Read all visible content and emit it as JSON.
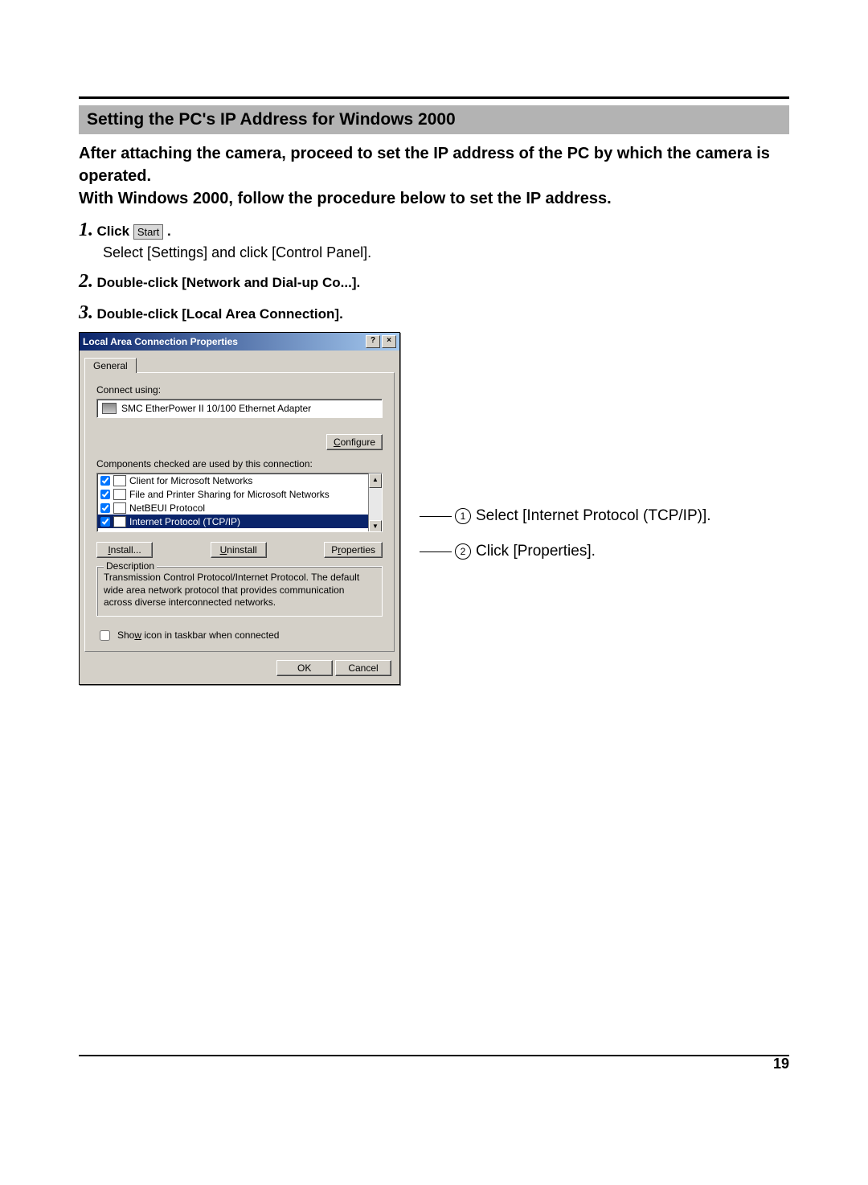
{
  "section_heading": "Setting the PC's IP Address for Windows 2000",
  "intro_line1": "After attaching the camera, proceed to set the IP address of the PC by which the camera is operated.",
  "intro_line2": "With Windows 2000, follow the procedure below to set the IP address.",
  "steps": {
    "s1_num": "1.",
    "s1_bold_prefix": "Click ",
    "s1_start_label": "Start",
    "s1_bold_suffix": " .",
    "s1_body": "Select [Settings] and click [Control Panel].",
    "s2_num": "2.",
    "s2_bold": "Double-click [Network and Dial-up Co...].",
    "s3_num": "3.",
    "s3_bold": "Double-click [Local Area Connection]."
  },
  "dialog": {
    "title": "Local Area Connection Properties",
    "help_btn": "?",
    "close_btn": "×",
    "tab": "General",
    "connect_label": "Connect using:",
    "adapter": "SMC EtherPower II 10/100 Ethernet Adapter",
    "configure_btn": "Configure",
    "components_label": "Components checked are used by this connection:",
    "components": [
      "Client for Microsoft Networks",
      "File and Printer Sharing for Microsoft Networks",
      "NetBEUI Protocol",
      "Internet Protocol (TCP/IP)"
    ],
    "install_btn": "Install...",
    "uninstall_btn": "Uninstall",
    "properties_btn": "Properties",
    "desc_legend": "Description",
    "desc_text": "Transmission Control Protocol/Internet Protocol. The default wide area network protocol that provides communication across diverse interconnected networks.",
    "show_icon": "Show icon in taskbar when connected",
    "ok_btn": "OK",
    "cancel_btn": "Cancel"
  },
  "callouts": {
    "c1": "Select [Internet Protocol (TCP/IP)].",
    "c2": "Click [Properties]."
  },
  "page_number": "19"
}
